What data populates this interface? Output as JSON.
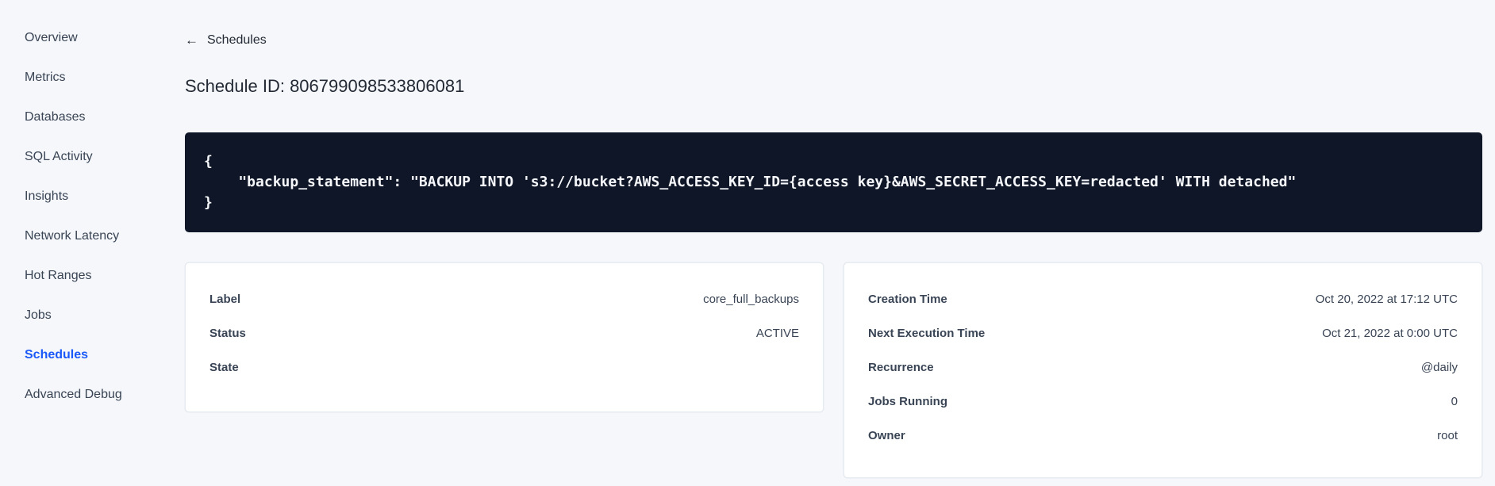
{
  "colors": {
    "accent_blue": "#1b59f8",
    "code_background": "#0e1627",
    "page_background": "#f5f7fa",
    "text_dark": "#242a35",
    "text_body": "#394455"
  },
  "sidebar": {
    "items": [
      {
        "label": "Overview",
        "active": false
      },
      {
        "label": "Metrics",
        "active": false
      },
      {
        "label": "Databases",
        "active": false
      },
      {
        "label": "SQL Activity",
        "active": false
      },
      {
        "label": "Insights",
        "active": false
      },
      {
        "label": "Network Latency",
        "active": false
      },
      {
        "label": "Hot Ranges",
        "active": false
      },
      {
        "label": "Jobs",
        "active": false
      },
      {
        "label": "Schedules",
        "active": true
      },
      {
        "label": "Advanced Debug",
        "active": false
      }
    ]
  },
  "header": {
    "back_label": "Schedules",
    "back_arrow": "←",
    "title": "Schedule ID: 806799098533806081"
  },
  "code_block": {
    "content": "{\n    \"backup_statement\": \"BACKUP INTO 's3://bucket?AWS_ACCESS_KEY_ID={access key}&AWS_SECRET_ACCESS_KEY=redacted' WITH detached\"\n}"
  },
  "summary_card": {
    "rows": [
      {
        "label": "Label",
        "value": "core_full_backups"
      },
      {
        "label": "Status",
        "value": "ACTIVE"
      },
      {
        "label": "State",
        "value": ""
      }
    ]
  },
  "details_card": {
    "rows": [
      {
        "label": "Creation Time",
        "value": "Oct 20, 2022 at 17:12 UTC"
      },
      {
        "label": "Next Execution Time",
        "value": "Oct 21, 2022 at 0:00 UTC"
      },
      {
        "label": "Recurrence",
        "value": "@daily"
      },
      {
        "label": "Jobs Running",
        "value": "0"
      },
      {
        "label": "Owner",
        "value": "root"
      }
    ]
  }
}
